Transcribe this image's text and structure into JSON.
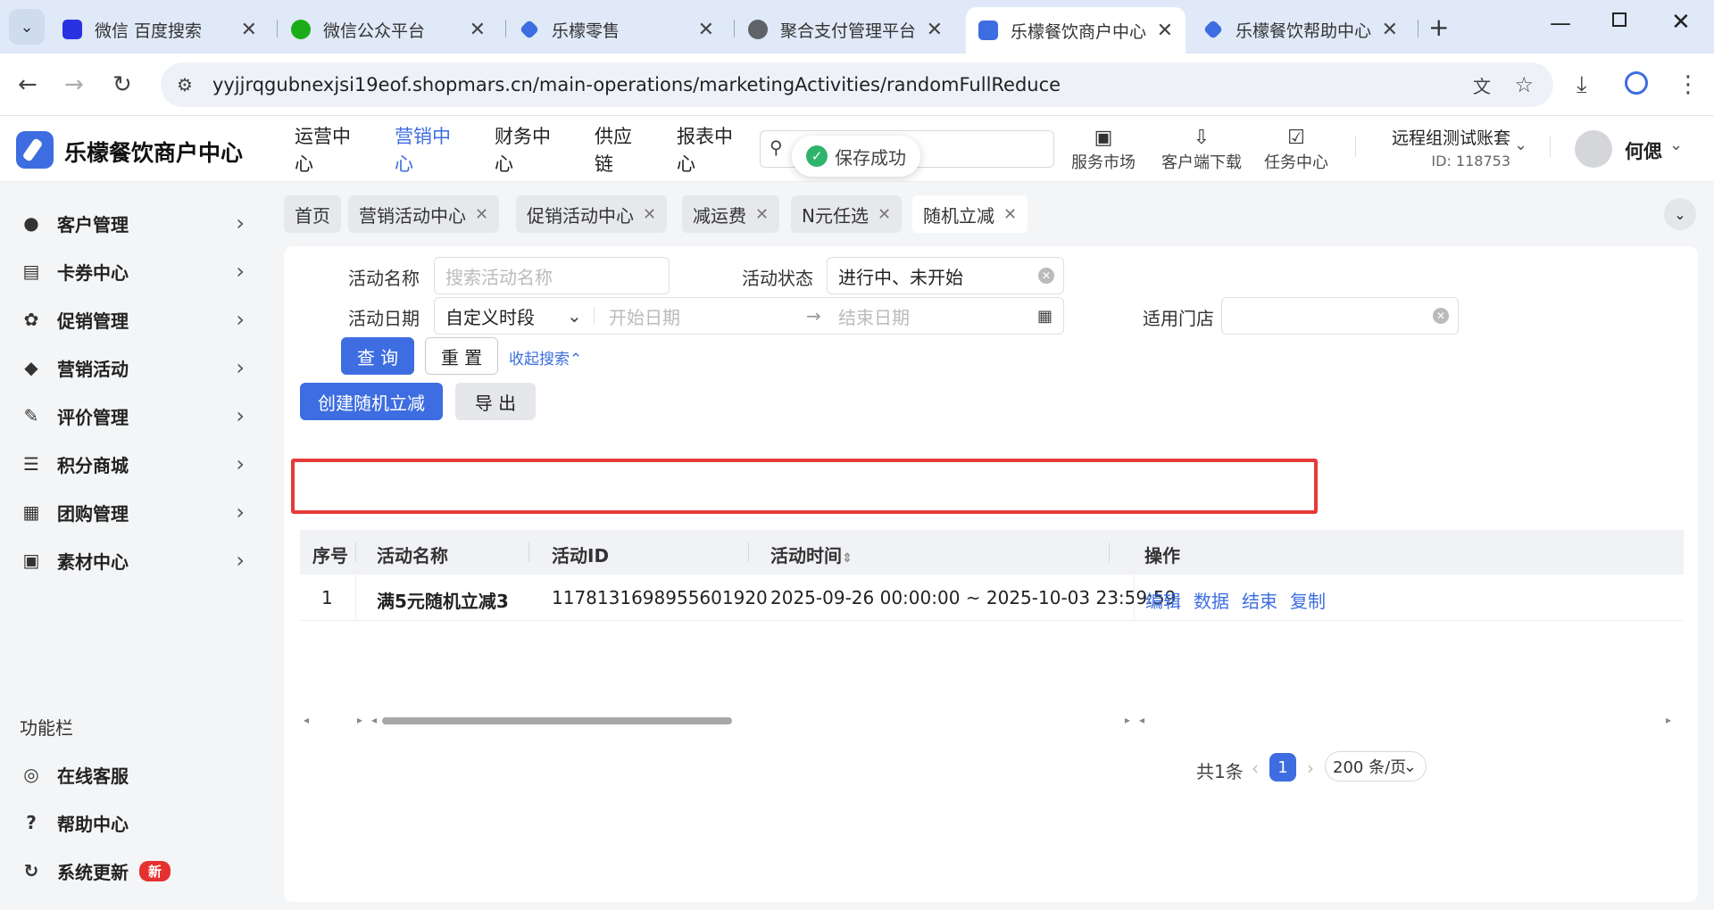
{
  "browser": {
    "tabs": [
      {
        "title": "微信 百度搜索",
        "icon": "baidu-icon",
        "color": "#2932e1"
      },
      {
        "title": "微信公众平台",
        "icon": "wechat-icon",
        "color": "#1aad19"
      },
      {
        "title": "乐檬零售",
        "icon": "lemeng-icon",
        "color": "#3d6de0"
      },
      {
        "title": "聚合支付管理平台",
        "icon": "globe-icon",
        "color": "#5f6368"
      },
      {
        "title": "乐檬餐饮商户中心",
        "icon": "lemeng-icon",
        "color": "#3d6de0",
        "active": true
      },
      {
        "title": "乐檬餐饮帮助中心",
        "icon": "lemeng-icon",
        "color": "#3d6de0"
      }
    ],
    "new_tab": "+",
    "url": "yyjjrqgubnexjsi19eof.shopmars.cn/main-operations/marketingActivities/randomFullReduce"
  },
  "app": {
    "brand": "乐檬餐饮商户中心",
    "nav": [
      {
        "label": "运营中\n心",
        "selected": false
      },
      {
        "label": "营销中\n心",
        "selected": true
      },
      {
        "label": "财务中\n心",
        "selected": false
      },
      {
        "label": "供应\n链",
        "selected": false
      },
      {
        "label": "报表中\n心",
        "selected": false
      }
    ],
    "toast": "保存成功",
    "tools": [
      {
        "label": "服务市场",
        "icon": "briefcase-icon"
      },
      {
        "label": "客户端下载",
        "icon": "download-folder-icon"
      },
      {
        "label": "任务中心",
        "icon": "clipboard-check-icon"
      }
    ],
    "account_name": "远程组测试账套",
    "account_id": "ID: 118753",
    "user_name": "何偲"
  },
  "sidebar": {
    "items": [
      {
        "label": "客户管理",
        "icon": "user-icon"
      },
      {
        "label": "卡券中心",
        "icon": "ticket-icon"
      },
      {
        "label": "促销管理",
        "icon": "promotion-icon"
      },
      {
        "label": "营销活动",
        "icon": "tag-icon"
      },
      {
        "label": "评价管理",
        "icon": "edit-icon"
      },
      {
        "label": "积分商城",
        "icon": "coins-icon"
      },
      {
        "label": "团购管理",
        "icon": "gift-icon"
      },
      {
        "label": "素材中心",
        "icon": "image-icon"
      }
    ],
    "section_title": "功能栏",
    "func_items": [
      {
        "label": "在线客服",
        "icon": "headset-icon"
      },
      {
        "label": "帮助中心",
        "icon": "help-icon"
      },
      {
        "label": "系统更新",
        "icon": "refresh-icon",
        "badge": "新"
      }
    ]
  },
  "page_tabs": [
    "首页",
    "营销活动中心",
    "促销活动中心",
    "减运费",
    "N元任选",
    "随机立减"
  ],
  "filters": {
    "name_label": "活动名称",
    "name_placeholder": "搜索活动名称",
    "status_label": "活动状态",
    "status_value": "进行中、未开始",
    "date_label": "活动日期",
    "date_mode": "自定义时段",
    "start_placeholder": "开始日期",
    "range_sep": "→",
    "end_placeholder": "结束日期",
    "store_label": "适用门店",
    "query_btn": "查 询",
    "reset_btn": "重 置",
    "collapse_link": "收起搜索"
  },
  "actions": {
    "create": "创建随机立减",
    "export": "导 出"
  },
  "table": {
    "headers": [
      "序号",
      "活动名称",
      "活动ID",
      "活动时间",
      "操作"
    ],
    "rows": [
      {
        "index": "1",
        "name": "满5元随机立减3",
        "id": "1178131698955601920",
        "time": "2025-09-26 00:00:00 ~ 2025-10-03 23:59:59",
        "ops": [
          "编辑",
          "数据",
          "结束",
          "复制"
        ]
      }
    ]
  },
  "pagination": {
    "total": "共1条",
    "page": "1",
    "page_size": "200 条/页"
  }
}
